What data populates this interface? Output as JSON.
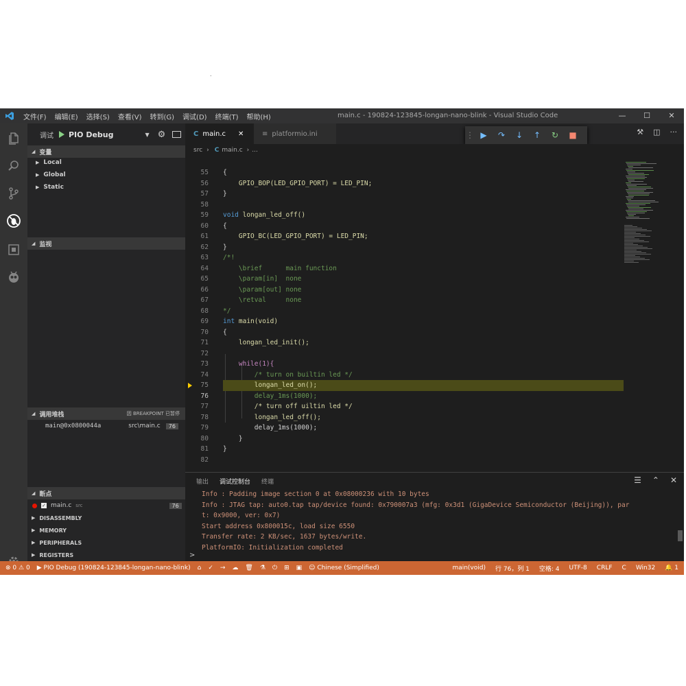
{
  "stray_mark": ".",
  "window": {
    "menu": [
      "文件(F)",
      "编辑(E)",
      "选择(S)",
      "查看(V)",
      "转到(G)",
      "调试(D)",
      "终端(T)",
      "帮助(H)"
    ],
    "title": "main.c - 190824-123845-longan-nano-blink - Visual Studio Code",
    "controls": [
      "—",
      "☐",
      "✕"
    ]
  },
  "sidebar": {
    "debug_label": "调试",
    "config": "PIO Debug",
    "sections": {
      "variables": "变量",
      "watch": "监视",
      "callstack": "调用堆栈",
      "callstack_right": "因 BREAKPOINT 已暂停",
      "breakpoints": "断点"
    },
    "variables": [
      "Local",
      "Global",
      "Static"
    ],
    "stack_frame": {
      "name": "main@0x0800044a",
      "file": "src\\main.c",
      "line": "76"
    },
    "breakpoint": {
      "file": "main.c",
      "dir": "src",
      "line": "76"
    },
    "extra_sections": [
      "DISASSEMBLY",
      "MEMORY",
      "PERIPHERALS",
      "REGISTERS"
    ],
    "badge": "1"
  },
  "editor": {
    "tabs": [
      {
        "label": "main.c"
      },
      {
        "label": "platformio.ini"
      }
    ],
    "breadcrumb": [
      "src",
      "main.c",
      "..."
    ],
    "current_line": "76",
    "lines": [
      {
        "n": "55",
        "code": "{"
      },
      {
        "n": "56",
        "code": "    GPIO_BOP(LED_GPIO_PORT) = LED_PIN;"
      },
      {
        "n": "57",
        "code": "}"
      },
      {
        "n": "58",
        "code": ""
      },
      {
        "n": "59",
        "code": "void longan_led_off()"
      },
      {
        "n": "60",
        "code": "{"
      },
      {
        "n": "61",
        "code": "    GPIO_BC(LED_GPIO_PORT) = LED_PIN;"
      },
      {
        "n": "62",
        "code": "}"
      },
      {
        "n": "63",
        "code": "/*!"
      },
      {
        "n": "64",
        "code": "    \\brief      main function"
      },
      {
        "n": "65",
        "code": "    \\param[in]  none"
      },
      {
        "n": "66",
        "code": "    \\param[out] none"
      },
      {
        "n": "67",
        "code": "    \\retval     none"
      },
      {
        "n": "68",
        "code": "*/"
      },
      {
        "n": "69",
        "code": "int main(void)"
      },
      {
        "n": "70",
        "code": "{"
      },
      {
        "n": "71",
        "code": "    longan_led_init();"
      },
      {
        "n": "72",
        "code": ""
      },
      {
        "n": "73",
        "code": "    while(1){"
      },
      {
        "n": "74",
        "code": "        /* turn on builtin led */"
      },
      {
        "n": "75",
        "code": "        longan_led_on();"
      },
      {
        "n": "76",
        "code": "        delay_1ms(1000);"
      },
      {
        "n": "77",
        "code": "        /* turn off uiltin led */"
      },
      {
        "n": "78",
        "code": "        longan_led_off();"
      },
      {
        "n": "79",
        "code": "        delay_1ms(1000);"
      },
      {
        "n": "80",
        "code": "    }"
      },
      {
        "n": "81",
        "code": "}"
      },
      {
        "n": "82",
        "code": ""
      }
    ]
  },
  "panel": {
    "tabs": [
      "输出",
      "调试控制台",
      "终端"
    ],
    "output": [
      "Info : Padding image section 0 at 0x08000236 with 10 bytes",
      "Info : JTAG tap: auto0.tap tap/device found: 0x790007a3 (mfg: 0x3d1 (GigaDevice Semiconductor (Beijing)), par",
      "t: 0x9000, ver: 0x7)",
      "Start address 0x800015c, load size 6550",
      "Transfer rate: 2 KB/sec, 1637 bytes/write.",
      "PlatformIO: Initialization completed"
    ],
    "prompt": ">"
  },
  "statusbar": {
    "errors": "0",
    "warnings": "0",
    "debug_session": "PIO Debug (190824-123845-longan-nano-blink)",
    "language": "Chinese (Simplified)",
    "function": "main(void)",
    "position": "行 76，列 1",
    "spaces": "空格: 4",
    "encoding": "UTF-8",
    "eol": "CRLF",
    "lang_mode": "C",
    "platform": "Win32",
    "notifications": "1"
  },
  "colors": {
    "statusbar": "#cc6633",
    "editor_bg": "#1e1e1e",
    "sidebar_bg": "#252526",
    "highlight": "#4b4b18"
  }
}
